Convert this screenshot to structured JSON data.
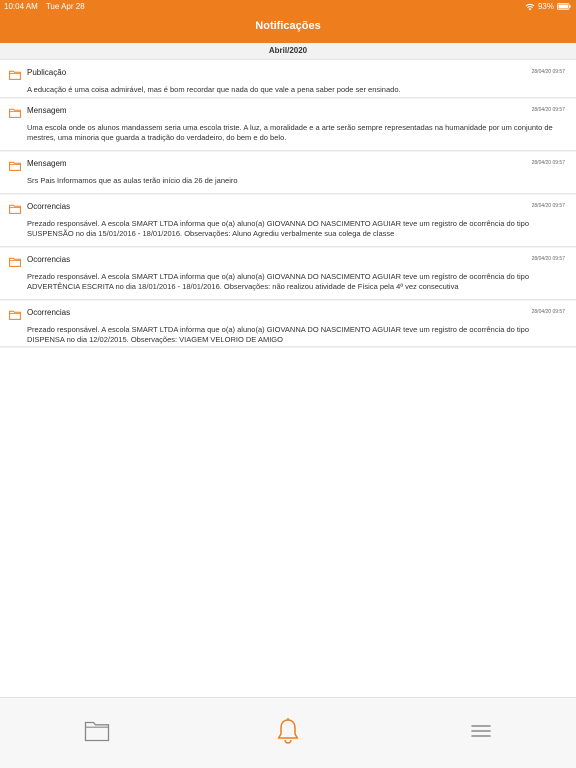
{
  "status_bar": {
    "time": "10:04 AM",
    "date": "Tue Apr 28",
    "battery": "93%"
  },
  "header": {
    "title": "Notificações"
  },
  "section": {
    "label": "Abril/2020"
  },
  "notifications": [
    {
      "type": "Publicação",
      "date": "28/04/20 09:57",
      "message": "A educação é uma coisa admirável, mas é bom recordar que nada do que vale a pena saber pode ser ensinado."
    },
    {
      "type": "Mensagem",
      "date": "28/04/20 09:57",
      "message": "Uma escola onde os alunos mandassem seria uma escola triste. A luz, a moralidade e a arte serão sempre representadas na humanidade por um conjunto de mestres, uma minoria que guarda a tradição do verdadeiro, do bem e do belo."
    },
    {
      "type": "Mensagem",
      "date": "28/04/20 09:57",
      "message": "Srs Pais Informamos que as aulas terão início dia 26 de janeiro"
    },
    {
      "type": "Ocorrencias",
      "date": "28/04/20 09:57",
      "message": "Prezado responsável. A escola SMART LTDA informa que o(a) aluno(a) GIOVANNA DO NASCIMENTO AGUIAR teve um registro de ocorrência do tipo SUSPENSÃO no dia 15/01/2016 - 18/01/2016. Observações: Aluno Agrediu verbalmente sua colega de classe"
    },
    {
      "type": "Ocorrencias",
      "date": "28/04/20 09:57",
      "message": "Prezado responsável. A escola SMART LTDA informa que o(a) aluno(a) GIOVANNA DO NASCIMENTO AGUIAR teve um registro de ocorrência do tipo ADVERTÊNCIA ESCRITA no dia 18/01/2016 - 18/01/2016. Observações: não realizou atividade de Física pela 4ª vez consecutiva"
    },
    {
      "type": "Ocorrencias",
      "date": "28/04/20 09:57",
      "message": "Prezado responsável. A escola SMART LTDA informa que o(a) aluno(a) GIOVANNA DO NASCIMENTO AGUIAR teve um registro de ocorrência do tipo DISPENSA no dia 12/02/2015. Observações: VIAGEM VELORIO DE AMIGO"
    }
  ],
  "tabbar": {
    "tabs": [
      {
        "icon": "folder-icon",
        "active": false
      },
      {
        "icon": "bell-icon",
        "active": true
      },
      {
        "icon": "menu-icon",
        "active": false
      }
    ]
  },
  "colors": {
    "accent": "#ee7d1e",
    "folder": "#ee7d1e",
    "inactive_icon": "#888888"
  }
}
